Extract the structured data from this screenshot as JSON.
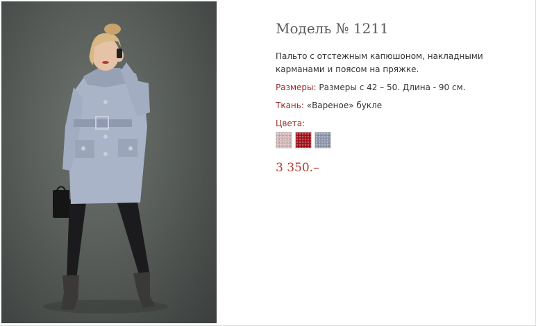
{
  "product": {
    "title": "Модель № 1211",
    "description": "Пальто с отстежным капюшоном, накладными карманами и поясом на пряжке.",
    "sizes_label": "Размеры:",
    "sizes_value": "Размеры с 42 – 50. Длина - 90 см.",
    "fabric_label": "Ткань:",
    "fabric_value": "«Вареное» букле",
    "colors_label": "Цвета:",
    "swatches": [
      {
        "name": "pink-boucle",
        "color": "#d4b8b8"
      },
      {
        "name": "red-boucle",
        "color": "#a3111a"
      },
      {
        "name": "grey-blue-boucle",
        "color": "#8e98ad"
      }
    ],
    "price": "3 350.–"
  },
  "photo": {
    "coat_color": "#a9b4c8",
    "background_color": "#5f6461"
  }
}
